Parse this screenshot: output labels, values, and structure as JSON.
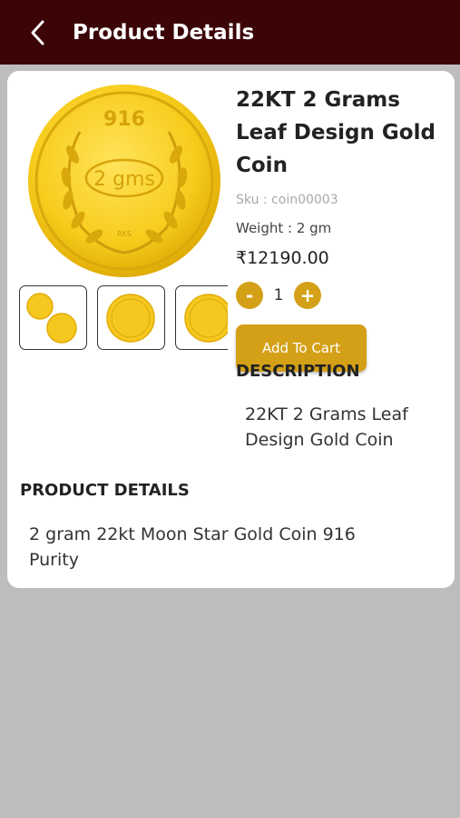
{
  "header": {
    "title": "Product Details",
    "back_icon": "chevron-left-icon",
    "background": "#3b0406"
  },
  "product": {
    "image_name": "gold-coin-image",
    "coin_text_top": "916",
    "coin_text_center": "2 gms",
    "coin_text_bottom": "RKS",
    "title": "22KT 2 Grams Leaf Design Gold Coin",
    "sku": "Sku : coin00003",
    "weight": "Weight : 2 gm",
    "price": "₹12190.00",
    "quantity": "1",
    "minus_label": "-",
    "plus_label": "+",
    "add_to_cart": "Add To Cart",
    "accent_color": "#d4a017"
  },
  "thumbnails": [
    {
      "name": "thumbnail-two-coins"
    },
    {
      "name": "thumbnail-coin-front"
    },
    {
      "name": "thumbnail-coin-back"
    }
  ],
  "description": {
    "heading": "DESCRIPTION",
    "text": "22KT 2 Grams Leaf Design Gold Coin"
  },
  "product_details": {
    "heading": "PRODUCT DETAILS",
    "text": "2 gram 22kt Moon Star Gold Coin 916 Purity"
  }
}
